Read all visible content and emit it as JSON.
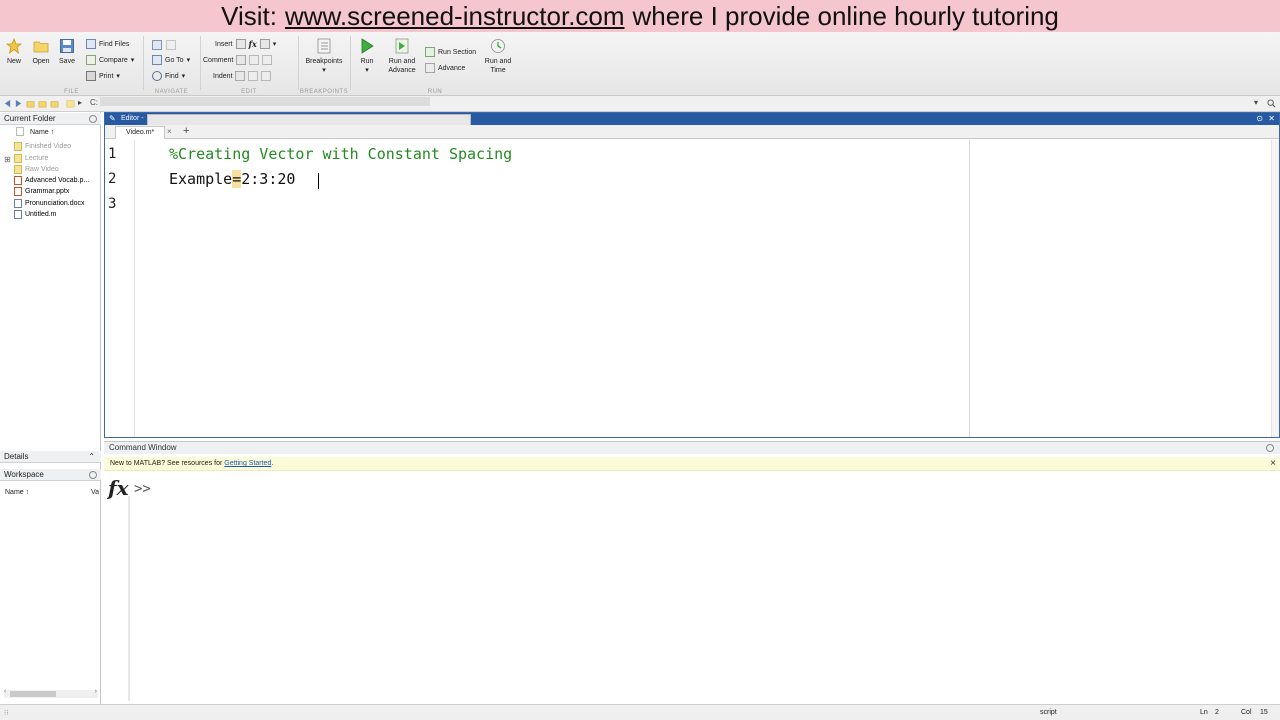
{
  "banner": {
    "prefix": "Visit:",
    "url": "www.screened-instructor.com",
    "suffix": "where I provide online hourly tutoring"
  },
  "toolstrip": {
    "file": {
      "label": "FILE",
      "new": "New",
      "open": "Open",
      "save": "Save",
      "find_files": "Find Files",
      "compare": "Compare",
      "print": "Print"
    },
    "navigate": {
      "label": "NAVIGATE",
      "go_to": "Go To",
      "find": "Find"
    },
    "edit": {
      "label": "EDIT",
      "insert": "Insert",
      "comment": "Comment",
      "indent": "Indent",
      "fx": "fx"
    },
    "breakpoints": {
      "label": "BREAKPOINTS",
      "breakpoints": "Breakpoints"
    },
    "run": {
      "label": "RUN",
      "run": "Run",
      "run_and_advance": "Run and Advance",
      "run_section": "Run Section",
      "advance": "Advance",
      "run_and_time": "Run and Time"
    }
  },
  "address": {
    "path": "C:"
  },
  "current_folder": {
    "title": "Current Folder",
    "column": "Name ↑",
    "items": [
      {
        "name": "Finished Video",
        "kind": "folder"
      },
      {
        "name": "Lecture",
        "kind": "folder"
      },
      {
        "name": "Raw Video",
        "kind": "folder"
      },
      {
        "name": "Advanced Vocab.p...",
        "kind": "ppt"
      },
      {
        "name": "Grammar.pptx",
        "kind": "ppt"
      },
      {
        "name": "Pronunciation.docx",
        "kind": "doc"
      },
      {
        "name": "Untitled.m",
        "kind": "doc"
      }
    ]
  },
  "details": {
    "title": "Details"
  },
  "workspace": {
    "title": "Workspace",
    "column": "Name ↑",
    "column2": "Va"
  },
  "editor": {
    "title": "Editor -",
    "tab": "Video.m*",
    "tab_close": "×",
    "tab_plus": "+",
    "lines": [
      {
        "num": "1",
        "text": "%Creating Vector with Constant Spacing",
        "kind": "comment"
      },
      {
        "num": "2",
        "before": "Example",
        "hl": "=",
        "after": "2:3:20",
        "kind": "code"
      },
      {
        "num": "3",
        "text": "",
        "kind": "code"
      }
    ]
  },
  "command_window": {
    "title": "Command Window",
    "notice_prefix": "New to MATLAB? See resources for",
    "notice_link": "Getting Started",
    "notice_suffix": ".",
    "close": "×",
    "fx": "fx",
    "prompt": ">>"
  },
  "status": {
    "mode": "script",
    "ln_label": "Ln",
    "ln": "2",
    "col_label": "Col",
    "col": "15"
  },
  "colors": {
    "banner": "#f6c6cf",
    "editor_title": "#2859a3",
    "comment": "#228b22",
    "highlight": "#f6dfa0"
  }
}
